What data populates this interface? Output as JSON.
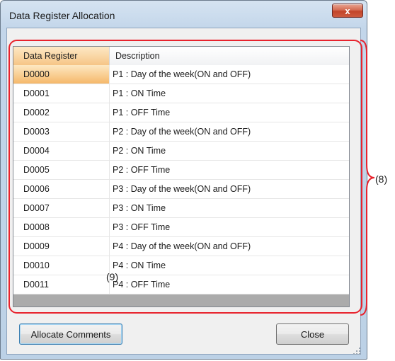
{
  "window": {
    "title": "Data Register Allocation",
    "close_glyph": "x",
    "accent_red": "#e8232d"
  },
  "grid": {
    "columns": [
      "Data Register",
      "Description"
    ],
    "rows": [
      {
        "register": "D0000",
        "description": "P1 : Day of the week(ON and OFF)"
      },
      {
        "register": "D0001",
        "description": "P1 : ON Time"
      },
      {
        "register": "D0002",
        "description": "P1 : OFF Time"
      },
      {
        "register": "D0003",
        "description": "P2 : Day of the week(ON and OFF)"
      },
      {
        "register": "D0004",
        "description": "P2 : ON Time"
      },
      {
        "register": "D0005",
        "description": "P2 : OFF Time"
      },
      {
        "register": "D0006",
        "description": "P3 : Day of the week(ON and OFF)"
      },
      {
        "register": "D0007",
        "description": "P3 : ON Time"
      },
      {
        "register": "D0008",
        "description": "P3 : OFF Time"
      },
      {
        "register": "D0009",
        "description": "P4 : Day of the week(ON and OFF)"
      },
      {
        "register": "D0010",
        "description": "P4 : ON Time"
      },
      {
        "register": "D0011",
        "description": "P4 : OFF Time"
      }
    ]
  },
  "buttons": {
    "allocate": "Allocate Comments",
    "close": "Close"
  },
  "callouts": {
    "grid_area": "(8)",
    "cell": "(9)"
  }
}
